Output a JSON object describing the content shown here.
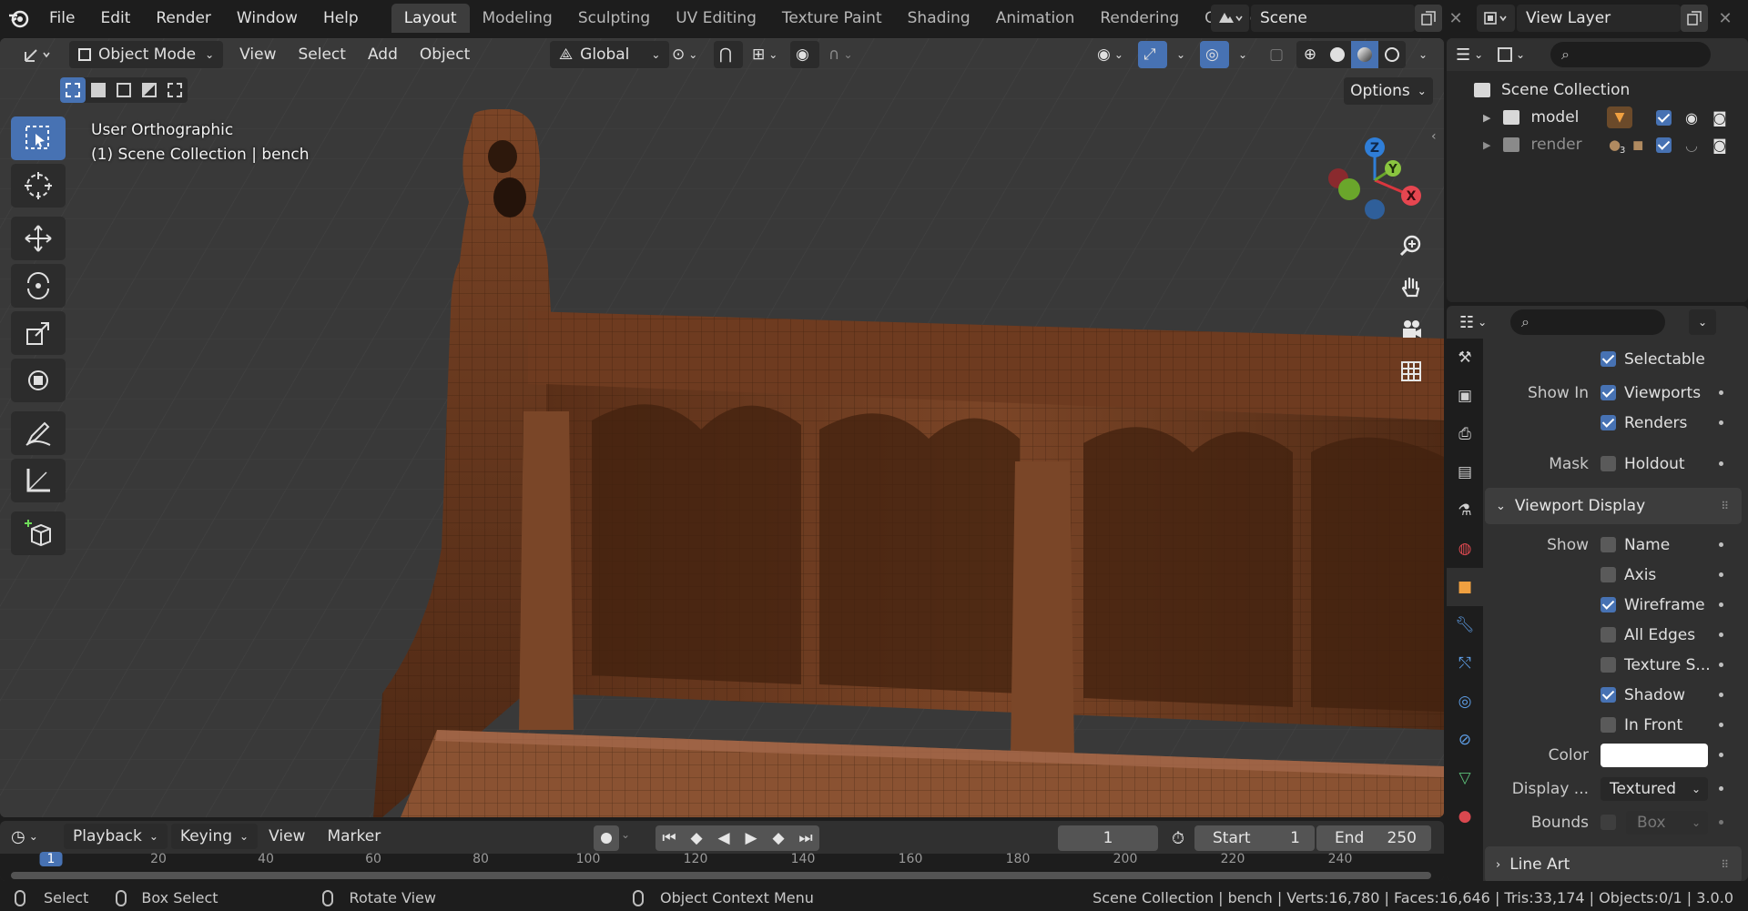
{
  "topbar": {
    "menus": [
      "File",
      "Edit",
      "Render",
      "Window",
      "Help"
    ],
    "workspaces": [
      "Layout",
      "Modeling",
      "Sculpting",
      "UV Editing",
      "Texture Paint",
      "Shading",
      "Animation",
      "Rendering",
      "Compo"
    ],
    "active_workspace": "Layout",
    "scene": "Scene",
    "view_layer": "View Layer"
  },
  "viewport": {
    "mode": "Object Mode",
    "menus": [
      "View",
      "Select",
      "Add",
      "Object"
    ],
    "transform_orientation": "Global",
    "view_name": "User Orthographic",
    "context": "(1) Scene Collection | bench",
    "options_label": "Options",
    "gizmo": {
      "z": "Z",
      "y": "Y",
      "x": "X"
    }
  },
  "outliner": {
    "root": "Scene Collection",
    "items": [
      {
        "name": "model"
      },
      {
        "name": "render",
        "badge": "3"
      }
    ]
  },
  "properties": {
    "visibility": {
      "selectable_label": "Selectable",
      "show_in_label": "Show In",
      "viewports_label": "Viewports",
      "renders_label": "Renders",
      "mask_label": "Mask",
      "holdout_label": "Holdout"
    },
    "viewport_display": {
      "title": "Viewport Display",
      "show_label": "Show",
      "options": [
        {
          "label": "Name",
          "checked": false
        },
        {
          "label": "Axis",
          "checked": false
        },
        {
          "label": "Wireframe",
          "checked": true
        },
        {
          "label": "All Edges",
          "checked": false
        },
        {
          "label": "Texture S...",
          "checked": false
        },
        {
          "label": "Shadow",
          "checked": true
        },
        {
          "label": "In Front",
          "checked": false
        }
      ],
      "color_label": "Color",
      "color_value": "#ffffff",
      "display_as_label": "Display ...",
      "display_as_value": "Textured",
      "bounds_label": "Bounds",
      "bounds_value": "Box"
    },
    "next_panel": "Line Art"
  },
  "timeline": {
    "menus": [
      "Playback",
      "Keying",
      "View",
      "Marker"
    ],
    "current_frame": "1",
    "start_label": "Start",
    "start_value": "1",
    "end_label": "End",
    "end_value": "250",
    "ruler_ticks": [
      "1",
      "20",
      "40",
      "60",
      "80",
      "100",
      "120",
      "140",
      "160",
      "180",
      "200",
      "220",
      "240"
    ]
  },
  "statusbar": {
    "select": "Select",
    "box_select": "Box Select",
    "rotate_view": "Rotate View",
    "context_menu": "Object Context Menu",
    "stats": "Scene Collection | bench | Verts:16,780 | Faces:16,646 | Tris:33,174 | Objects:0/1 | 3.0.0"
  },
  "colors": {
    "accent": "#4772b3",
    "wood": "#6b3a20",
    "viewport_bg": "#393939"
  }
}
